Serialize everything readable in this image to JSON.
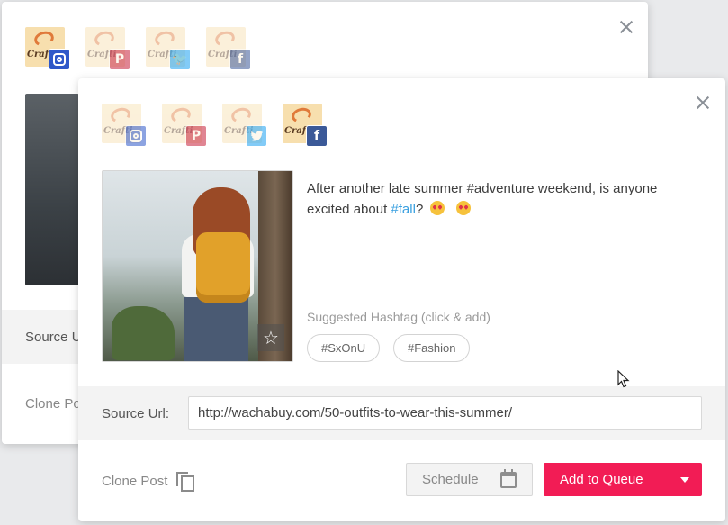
{
  "back_card": {
    "accounts": [
      {
        "network": "instagram",
        "active": true,
        "brand_text": "Crafti"
      },
      {
        "network": "pinterest",
        "active": false,
        "brand_text": "Crafti"
      },
      {
        "network": "twitter",
        "active": false,
        "brand_text": "Crafti"
      },
      {
        "network": "facebook",
        "active": false,
        "brand_text": "Crafti"
      }
    ],
    "source_label": "Source U",
    "clone_label": "Clone Po"
  },
  "front_card": {
    "accounts": [
      {
        "network": "instagram",
        "active": false,
        "brand_text": "Crafti",
        "icon": "instagram-icon"
      },
      {
        "network": "pinterest",
        "active": false,
        "brand_text": "Crafti",
        "icon": "pinterest-icon",
        "glyph": "P"
      },
      {
        "network": "twitter",
        "active": false,
        "brand_text": "Crafti",
        "icon": "twitter-icon",
        "glyph": "✉"
      },
      {
        "network": "facebook",
        "active": true,
        "brand_text": "Crafti",
        "icon": "facebook-icon",
        "glyph": "f"
      }
    ],
    "caption": {
      "text_before": "After another late summer #adventure weekend, is anyone excited about ",
      "hashtag_link": "#fall",
      "text_after": "?"
    },
    "suggested_title": "Suggested Hashtag (click & add)",
    "hashtags": [
      "#SxOnU",
      "#Fashion"
    ],
    "source_label": "Source Url:",
    "source_value": "http://wachabuy.com/50-outfits-to-wear-this-summer/",
    "clone_label": "Clone Post",
    "schedule_label": "Schedule",
    "queue_label": "Add to Queue",
    "star_glyph": "☆"
  },
  "colors": {
    "accent": "#f21c55",
    "link": "#3aa0e0",
    "instagram": "#2f58c9",
    "pinterest": "#c8233c",
    "twitter": "#1da1f2",
    "facebook": "#3b5998"
  }
}
